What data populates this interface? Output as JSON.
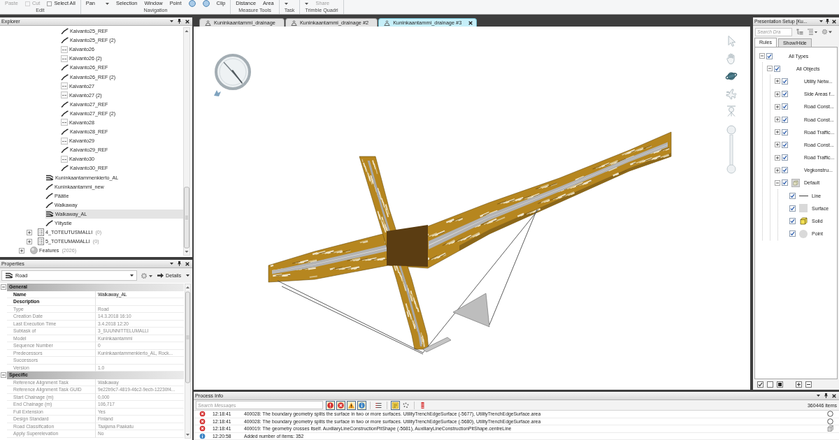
{
  "ribbon": {
    "groups": [
      {
        "label": "Edit",
        "commands": [
          {
            "label": "Paste",
            "kind": "large",
            "disabled": true
          },
          {
            "label": "Cut",
            "kind": "small",
            "disabled": true
          },
          {
            "label": "Select All",
            "kind": "small",
            "disabled": false
          }
        ]
      },
      {
        "label": "Navigation",
        "commands": [
          {
            "label": "Pan",
            "kind": "menu",
            "disabled": false
          },
          {
            "label": "Selection",
            "kind": "large",
            "disabled": false
          },
          {
            "label": "Window",
            "kind": "large",
            "disabled": false
          },
          {
            "label": "Point",
            "kind": "large",
            "disabled": false
          },
          {
            "kind": "round",
            "disabled": false
          },
          {
            "kind": "round",
            "disabled": false
          },
          {
            "label": "Clip",
            "kind": "large",
            "disabled": false
          }
        ]
      },
      {
        "label": "Measure Tools",
        "commands": [
          {
            "label": "Distance",
            "kind": "large",
            "disabled": false
          },
          {
            "label": "Area",
            "kind": "large",
            "disabled": false
          }
        ]
      },
      {
        "label": "Task",
        "commands": [
          {
            "kind": "menu",
            "disabled": false
          }
        ]
      },
      {
        "label": "Trimble Quadri",
        "commands": [
          {
            "kind": "menu",
            "disabled": false
          },
          {
            "label": "Share",
            "kind": "large",
            "disabled": true
          }
        ]
      }
    ]
  },
  "explorer": {
    "title": "Explorer",
    "tree": [
      {
        "children": [
          {
            "children": [
              {
                "children": [
                  {
                    "children": [
                      {
                        "label": "Kaivanto25_REF",
                        "kind": "alignment",
                        "selected": false
                      },
                      {
                        "label": "Kaivanto25_REF (2)",
                        "kind": "alignment",
                        "selected": false
                      },
                      {
                        "label": "Kaivanto26",
                        "kind": "plain",
                        "selected": false
                      },
                      {
                        "label": "Kaivanto26 (2)",
                        "kind": "plain",
                        "selected": false
                      },
                      {
                        "label": "Kaivanto26_REF",
                        "kind": "alignment",
                        "selected": false
                      },
                      {
                        "label": "Kaivanto26_REF (2)",
                        "kind": "alignment",
                        "selected": false
                      },
                      {
                        "label": "Kaivanto27",
                        "kind": "plain",
                        "selected": false
                      },
                      {
                        "label": "Kaivanto27 (2)",
                        "kind": "plain",
                        "selected": false
                      },
                      {
                        "label": "Kaivanto27_REF",
                        "kind": "alignment",
                        "selected": false
                      },
                      {
                        "label": "Kaivanto27_REF (2)",
                        "kind": "alignment",
                        "selected": false
                      },
                      {
                        "label": "Kaivanto28",
                        "kind": "plain",
                        "selected": false
                      },
                      {
                        "label": "Kaivanto28_REF",
                        "kind": "alignment",
                        "selected": false
                      },
                      {
                        "label": "Kaivanto29",
                        "kind": "plain",
                        "selected": false
                      },
                      {
                        "label": "Kaivanto29_REF",
                        "kind": "alignment",
                        "selected": false
                      },
                      {
                        "label": "Kaivanto30",
                        "kind": "plain",
                        "selected": false
                      },
                      {
                        "label": "Kaivanto30_REF",
                        "kind": "alignment",
                        "selected": false
                      }
                    ]
                  }
                ]
              },
              {
                "label": "Kuninkaantammenkierto_AL",
                "kind": "road",
                "selected": false
              },
              {
                "label": "Kuninkaantammi_new",
                "kind": "alignment",
                "selected": false
              },
              {
                "label": "Päätie",
                "kind": "alignment",
                "selected": false
              },
              {
                "label": "Walkaway",
                "kind": "alignment",
                "selected": false
              },
              {
                "label": "Walkaway_AL",
                "kind": "road",
                "selected": true
              },
              {
                "label": "Ylitystie",
                "kind": "alignment",
                "selected": false
              }
            ]
          },
          {
            "label": "4_TOTEUTUSMALLI",
            "count": "(0)",
            "kind": "model",
            "expanded": false,
            "selected": false
          },
          {
            "label": "5_TOTEUMAMALLI",
            "count": "(0)",
            "kind": "model",
            "expanded": false,
            "selected": false
          }
        ]
      },
      {
        "label": "Features",
        "count": "(2026)",
        "kind": "features",
        "expanded": false,
        "selected": false
      }
    ]
  },
  "properties": {
    "title": "Properties",
    "object_type": "Road",
    "view_button": "Details",
    "sections": [
      {
        "title": "General",
        "expanded": true,
        "rows": [
          {
            "name": "Name",
            "value": "Walkaway_AL",
            "readonly": false
          },
          {
            "name": "Description",
            "readonly": false
          },
          {
            "name": "Type",
            "value": "Road",
            "readonly": true
          },
          {
            "name": "Creation Date",
            "value": "14.3.2018 16:10",
            "readonly": true
          },
          {
            "name": "Last Execution Time",
            "value": "3.4.2018 12:20",
            "readonly": true
          },
          {
            "name": "Subtask of",
            "value": "3_SUUNNITTELUMALLI",
            "readonly": true
          },
          {
            "name": "Model",
            "value": "Kuninkaantammi",
            "readonly": true
          },
          {
            "name": "Sequence Number",
            "value": "0",
            "readonly": true
          },
          {
            "name": "Predecessors",
            "value": "Kuninkaantammenkierto_AL, Rock...",
            "readonly": true
          },
          {
            "name": "Successors",
            "readonly": true
          },
          {
            "name": "Version",
            "value": "1.0",
            "readonly": true
          }
        ]
      },
      {
        "title": "Specific",
        "expanded": true,
        "rows": [
          {
            "name": "Reference Alignment Task",
            "value": "Walkaway",
            "readonly": true
          },
          {
            "name": "Reference Alignment Task GUID",
            "value": "9e22b9c7-4819-46c2-9ecb-12230f4...",
            "readonly": true
          },
          {
            "name": "Start Chainage (m)",
            "value": "0,000",
            "readonly": true
          },
          {
            "name": "End Chainage (m)",
            "value": "106,717",
            "readonly": true
          },
          {
            "name": "Full Extension",
            "value": "Yes",
            "readonly": true
          },
          {
            "name": "Design Standard",
            "value": "Finland",
            "readonly": true
          },
          {
            "name": "Road Classification",
            "value": "Taajama Paakatu",
            "readonly": true
          },
          {
            "name": "Apply Superelevation",
            "value": "No",
            "readonly": true
          }
        ]
      }
    ]
  },
  "tabs": [
    {
      "label": "Kuninkaantammi_drainage",
      "selected": false
    },
    {
      "label": "Kuninkaantammi_drainage #2",
      "selected": false
    },
    {
      "label": "Kuninkaantammi_drainage #3",
      "selected": true
    }
  ],
  "viewport": {
    "tools": [
      {
        "kind": "select",
        "selected": false
      },
      {
        "kind": "pan",
        "selected": false
      },
      {
        "kind": "orbit",
        "selected": true
      },
      {
        "kind": "fly",
        "selected": false
      },
      {
        "kind": "look",
        "selected": false
      }
    ],
    "zoom_slider": {
      "level": 1
    }
  },
  "presentation": {
    "title": "Presentation Setup [Ku...",
    "search": {
      "placeholder": "Search Dra"
    },
    "tabs": [
      {
        "label": "Rules",
        "selected": true
      },
      {
        "label": "Show/Hide",
        "selected": false
      }
    ],
    "rules": [
      {
        "label": "All Types",
        "checked": true,
        "expanded": true,
        "children": [
          {
            "label": "All Objects",
            "checked": true,
            "expanded": true,
            "children": [
              {
                "label": "Utility Netw...",
                "checked": true,
                "expanded": false
              },
              {
                "label": "Side Areas f...",
                "checked": true,
                "expanded": false
              },
              {
                "label": "Road Const...",
                "checked": true,
                "expanded": false
              },
              {
                "label": "Road Const...",
                "checked": true,
                "expanded": false
              },
              {
                "label": "Road Traffic...",
                "checked": true,
                "expanded": false
              },
              {
                "label": "Road Const...",
                "checked": true,
                "expanded": false
              },
              {
                "label": "Road Traffic...",
                "checked": true,
                "expanded": false
              },
              {
                "label": "Vegkonstru...",
                "checked": true,
                "expanded": false
              },
              {
                "label": "Default",
                "kind": "default",
                "checked": true,
                "expanded": true,
                "children": [
                  {
                    "label": "Line",
                    "kind": "line",
                    "checked": true
                  },
                  {
                    "label": "Surface",
                    "kind": "surface",
                    "checked": true
                  },
                  {
                    "label": "Solid",
                    "kind": "solid",
                    "checked": true
                  },
                  {
                    "label": "Point",
                    "kind": "point",
                    "checked": true
                  }
                ]
              }
            ]
          }
        ]
      }
    ]
  },
  "process": {
    "title": "Process Info",
    "search": {
      "placeholder": "Search Messages"
    },
    "filters": [
      {
        "kind": "critical",
        "on": true
      },
      {
        "kind": "error",
        "on": true
      },
      {
        "kind": "warning",
        "on": true
      },
      {
        "kind": "info",
        "on": true
      }
    ],
    "tools": [
      {
        "kind": "columns",
        "on": false
      },
      {
        "kind": "highlight",
        "on": true
      },
      {
        "kind": "scatter",
        "on": false
      },
      {
        "kind": "clear",
        "on": false
      }
    ],
    "item_count": "360446 items",
    "messages": [
      {
        "kind": "error",
        "time": "12:18:41",
        "text": "400028: The boundary geometry splits the surface in two or more surfaces. UtilityTrenchEdgeSurface (-5677), UtilityTrenchEdgeSurface.area",
        "preview": {
          "kind": "circle"
        }
      },
      {
        "kind": "error",
        "time": "12:18:41",
        "text": "400028: The boundary geometry splits the surface in two or more surfaces. UtilityTrenchEdgeSurface (-5680), UtilityTrenchEdgeSurface.area",
        "preview": {
          "kind": "circle"
        }
      },
      {
        "kind": "error",
        "time": "12:18:41",
        "text": "400019: The geometry crosses itself. AuxiliaryLineConstructionPitShape (-5681), AuxiliaryLineConstructionPitShape.centreLine",
        "preview": {
          "kind": "cube"
        }
      },
      {
        "kind": "info",
        "time": "12:20:58",
        "text": "Added number of items: 352"
      }
    ]
  }
}
